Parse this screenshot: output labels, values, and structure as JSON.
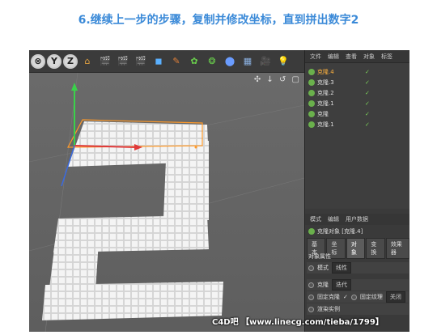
{
  "title": "6.继续上一步的步骤，复制并修改坐标，直到拼出数字2",
  "toolbar": {
    "axis_y": "Y",
    "axis_z": "Z",
    "icons": [
      "axis-x-icon",
      "axis-y-icon",
      "axis-z-icon",
      "coordinate-icon",
      "render-region-icon",
      "render-view-icon",
      "render-settings-icon",
      "cube-icon",
      "pen-icon",
      "cloner-icon",
      "deformer-icon",
      "scene-icon",
      "floor-icon",
      "camera-icon",
      "light-icon"
    ]
  },
  "viewport": {
    "nav_icons": "✣ ↓ ↺ ▢"
  },
  "object_manager": {
    "menu": [
      "文件",
      "编辑",
      "查看",
      "对象",
      "标签"
    ],
    "objects": [
      {
        "name": "克隆.4",
        "selected": true
      },
      {
        "name": "克隆.3",
        "selected": false
      },
      {
        "name": "克隆.2",
        "selected": false
      },
      {
        "name": "克隆.1",
        "selected": false
      },
      {
        "name": "克隆",
        "selected": false
      },
      {
        "name": "克隆.1",
        "selected": false
      }
    ]
  },
  "attributes": {
    "menu": [
      "模式",
      "编辑",
      "用户数据"
    ],
    "object_title": "克隆对象 [克隆.4]",
    "tabs": [
      "基本",
      "坐标",
      "对象",
      "变换",
      "效果器"
    ],
    "active_tab": "对象",
    "section": "对象属性",
    "mode_label": "模式",
    "mode_value": "线性",
    "clones_label": "克隆",
    "clones_value": "迭代",
    "fix_clone_label": "固定克隆",
    "fix_clone_check": "✓",
    "fix_texture_label": "固定纹理",
    "fix_texture_value": "关闭",
    "render_instance_label": "渲染实例"
  },
  "watermark": "C4D吧 【www.linecg.com/tieba/1799】"
}
